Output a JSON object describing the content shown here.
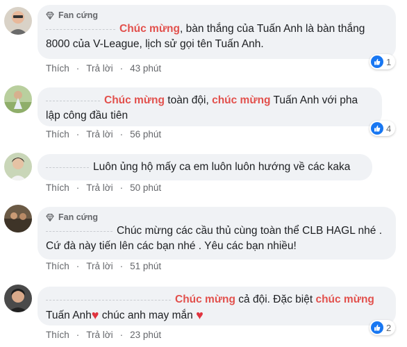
{
  "comments": [
    {
      "badge": "Fan cứng",
      "segments": [
        {
          "text": "Chúc mừng",
          "hl": true
        },
        {
          "text": ", bàn thắng của Tuấn Anh là bàn thắng 8000 của V-League, lịch sử gọi tên Tuấn Anh.",
          "hl": false
        }
      ],
      "like": "Thích",
      "reply": "Trả lời",
      "time": "43 phút",
      "reactions": "1"
    },
    {
      "badge": "",
      "segments": [
        {
          "text": "Chúc mừng",
          "hl": true
        },
        {
          "text": " toàn đội, ",
          "hl": false
        },
        {
          "text": "chúc mừng",
          "hl": true
        },
        {
          "text": " Tuấn Anh với pha lập công đầu tiên",
          "hl": false
        }
      ],
      "like": "Thích",
      "reply": "Trả lời",
      "time": "56 phút",
      "reactions": "4"
    },
    {
      "badge": "",
      "segments": [
        {
          "text": "Luôn ủng hộ mấy ca em luôn luôn hướng về các kaka",
          "hl": false
        }
      ],
      "like": "Thích",
      "reply": "Trả lời",
      "time": "50 phút",
      "reactions": ""
    },
    {
      "badge": "Fan cứng",
      "segments": [
        {
          "text": "Chúc mừng các cầu thủ cùng toàn thể CLB HAGL nhé . Cứ đà này tiến lên các bạn nhé . Yêu các bạn nhiều!",
          "hl": false
        }
      ],
      "like": "Thích",
      "reply": "Trả lời",
      "time": "51 phút",
      "reactions": ""
    },
    {
      "badge": "",
      "segments": [
        {
          "text": "Chúc mừng",
          "hl": true
        },
        {
          "text": " cả đội. Đặc biệt ",
          "hl": false
        },
        {
          "text": "chúc mừng",
          "hl": true
        },
        {
          "text": " Tuấn Anh",
          "hl": false
        },
        {
          "text": "♥",
          "heart": true
        },
        {
          "text": " chúc anh may mắn ",
          "hl": false
        },
        {
          "text": "♥",
          "heart": true
        }
      ],
      "like": "Thích",
      "reply": "Trả lời",
      "time": "23 phút",
      "reactions": "2"
    }
  ],
  "colors": {
    "highlight": "#e2504c",
    "like": "#1877f2",
    "bubble": "#f0f2f5"
  }
}
